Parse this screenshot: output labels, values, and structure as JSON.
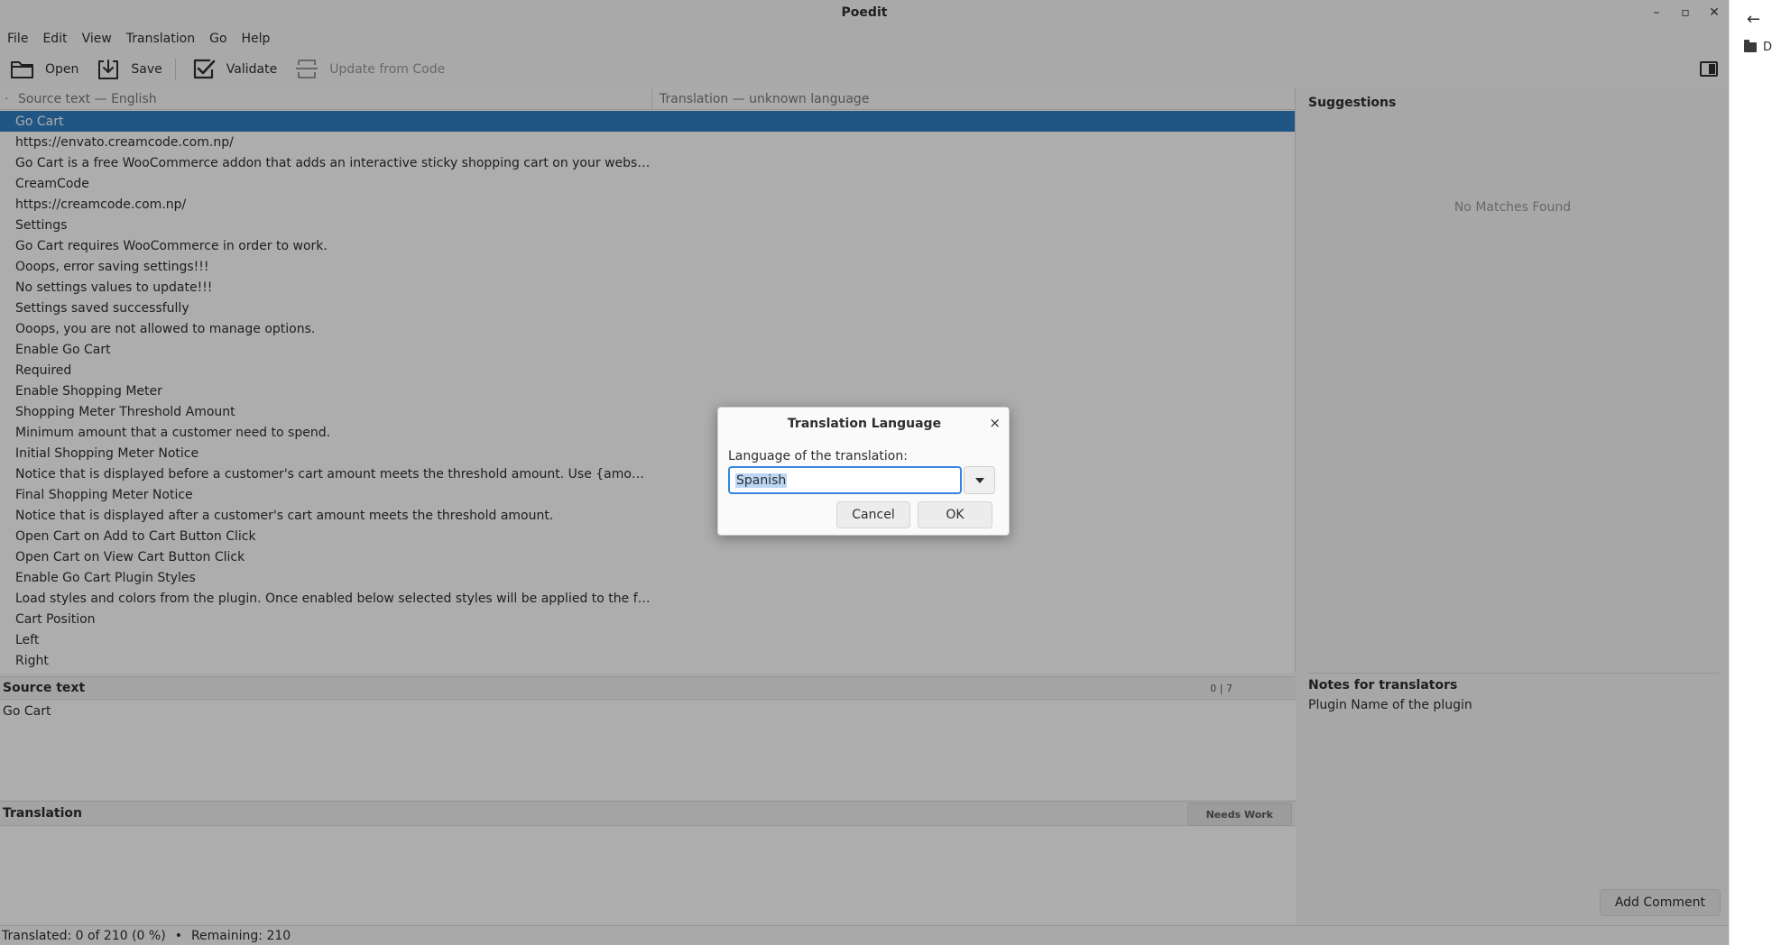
{
  "window": {
    "title": "Poedit",
    "controls": {
      "minimize": "–",
      "restore": "▫",
      "close": "✕"
    }
  },
  "menu": [
    "File",
    "Edit",
    "View",
    "Translation",
    "Go",
    "Help"
  ],
  "toolbar": {
    "open_label": "Open",
    "save_label": "Save",
    "validate_label": "Validate",
    "update_label": "Update from Code"
  },
  "list": {
    "source_header": "Source text — English",
    "translation_header": "Translation — unknown language",
    "selected_index": 0,
    "rows": [
      "Go Cart",
      "https://envato.creamcode.com.np/",
      "Go Cart is a free WooCommerce addon that adds an interactive sticky shopping cart on your website allowi...",
      "CreamCode",
      "https://creamcode.com.np/",
      "Settings",
      "Go Cart requires WooCommerce in order to work.",
      "Ooops, error saving settings!!!",
      "No settings values to update!!!",
      "Settings saved successfully",
      "Ooops, you are not allowed to manage options.",
      "Enable Go Cart",
      "Required",
      "Enable Shopping Meter",
      "Shopping Meter Threshold Amount",
      "Minimum amount that a customer need to spend.",
      "Initial Shopping Meter Notice",
      "Notice that is displayed before a customer's cart amount meets the threshold amount. Use {amount} place...",
      "Final Shopping Meter Notice",
      "Notice that is displayed after a customer's cart amount meets the threshold amount.",
      "Open Cart on Add to Cart Button Click",
      "Open Cart on View Cart Button Click",
      "Enable Go Cart Plugin Styles",
      "Load styles and colors from the plugin. Once enabled below selected styles will be applied to the front-end...",
      "Cart Position",
      "Left",
      "Right"
    ]
  },
  "editor": {
    "source_label": "Source text",
    "source_count": "0 | 7",
    "source_text": "Go Cart",
    "translation_label": "Translation",
    "needs_work_label": "Needs Work"
  },
  "sidebar": {
    "suggestions_title": "Suggestions",
    "no_matches": "No Matches Found",
    "notes_title": "Notes for translators",
    "notes_text": "Plugin Name of the plugin",
    "add_comment_label": "Add Comment"
  },
  "status": {
    "translated": "Translated: 0 of 210 (0 %)",
    "separator": "•",
    "remaining": "Remaining: 210"
  },
  "dialog": {
    "title": "Translation Language",
    "close": "×",
    "label": "Language of the translation:",
    "value": "Spanish",
    "cancel_label": "Cancel",
    "ok_label": "OK"
  },
  "edge_window": {
    "back": "←",
    "item_text": "D"
  },
  "colors": {
    "selection": "#2f7fc1",
    "focus": "#3584e4",
    "text_selection": "#bcd7f5"
  }
}
